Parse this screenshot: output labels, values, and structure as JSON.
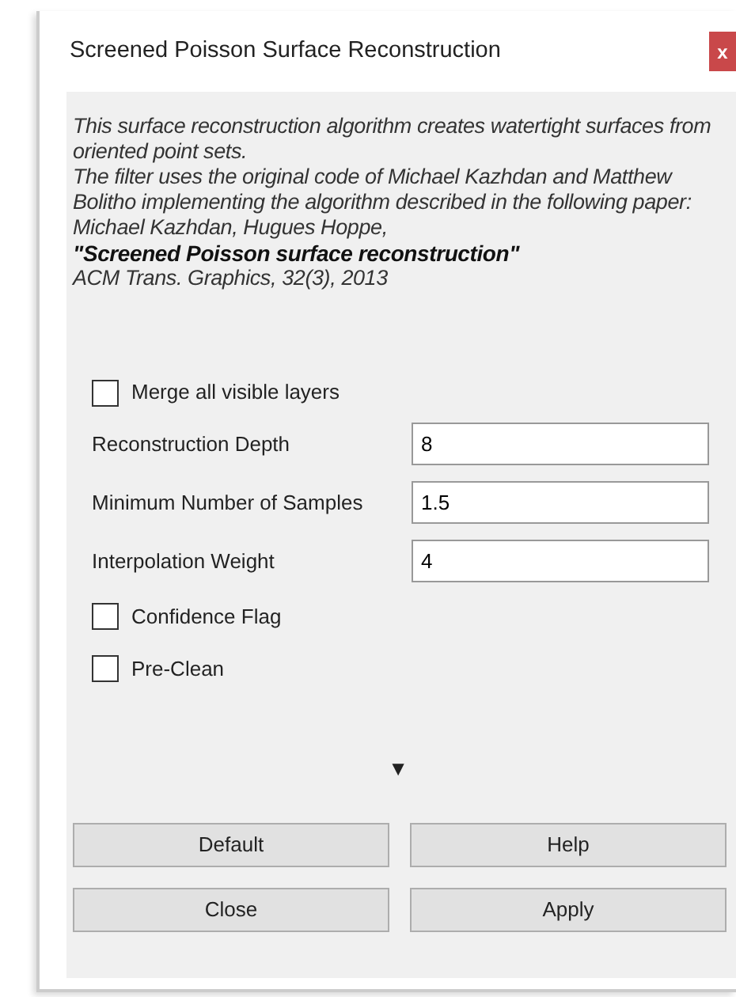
{
  "window": {
    "title": "Screened Poisson Surface Reconstruction",
    "close": "x"
  },
  "description": [
    {
      "text": "This surface reconstruction algorithm creates watertight surfaces from oriented point sets.",
      "bold": false
    },
    {
      "text": "The filter uses the original code of Michael Kazhdan and Matthew Bolitho implementing the algorithm described in the following paper:",
      "bold": false
    },
    {
      "text": "Michael Kazhdan, Hugues Hoppe,",
      "bold": false
    },
    {
      "text": "\"Screened Poisson surface reconstruction\"",
      "bold": true
    },
    {
      "text": "ACM Trans. Graphics, 32(3), 2013",
      "bold": false
    }
  ],
  "parameters": [
    {
      "kind": "checkbox",
      "label": "Merge all visible layers",
      "checked": false
    },
    {
      "kind": "number",
      "label": "Reconstruction Depth",
      "value": "8"
    },
    {
      "kind": "number",
      "label": "Minimum Number of Samples",
      "value": "1.5"
    },
    {
      "kind": "number",
      "label": "Interpolation Weight",
      "value": "4"
    },
    {
      "kind": "checkbox",
      "label": "Confidence Flag",
      "checked": false
    },
    {
      "kind": "checkbox",
      "label": "Pre-Clean",
      "checked": false
    }
  ],
  "expand_arrow": "▼",
  "buttons": [
    [
      "Default",
      "Help"
    ],
    [
      "Close",
      "Apply"
    ]
  ]
}
